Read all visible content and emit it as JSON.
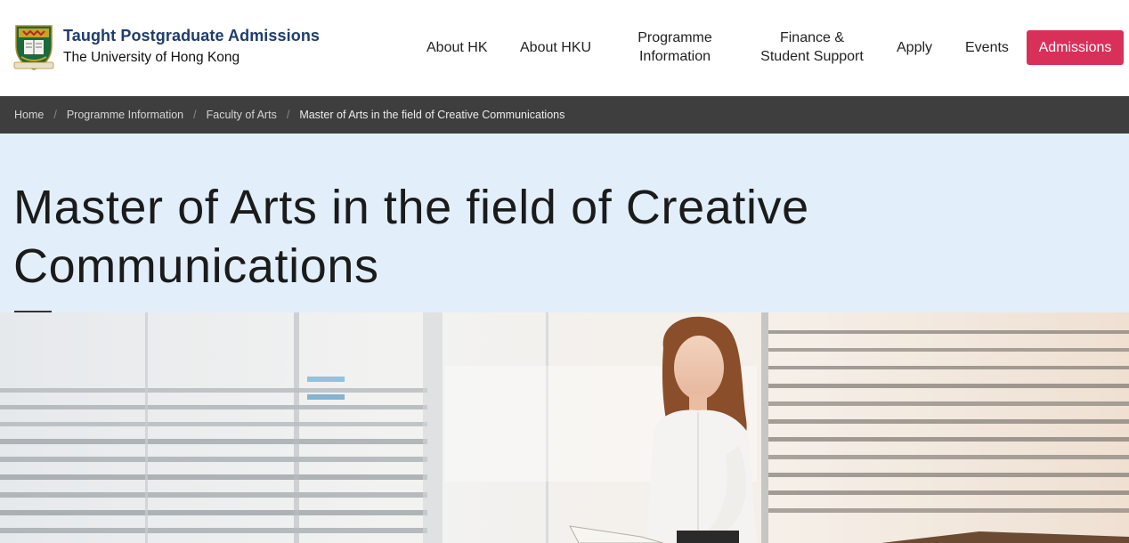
{
  "brand": {
    "title": "Taught Postgraduate Admissions",
    "subtitle": "The University of Hong Kong",
    "crest_icon": "hku-crest-icon"
  },
  "nav": {
    "about_hk": "About HK",
    "about_hku": "About HKU",
    "programme_line1": "Programme",
    "programme_line2": "Information",
    "finance_line1": "Finance &",
    "finance_line2": "Student Support",
    "apply": "Apply",
    "events": "Events",
    "admissions": "Admissions"
  },
  "breadcrumb": {
    "items": [
      "Home",
      "Programme Information",
      "Faculty of Arts"
    ],
    "current": "Master of Arts in the field of Creative Communications",
    "separator": "/"
  },
  "page": {
    "title_line1": "Master of Arts in the field of Creative",
    "title_line2": "Communications"
  },
  "colors": {
    "brand_blue": "#1f3d6d",
    "accent_red": "#d9305a",
    "breadcrumb_bg": "#3e3e3e",
    "title_band_bg": "#e2effb"
  }
}
